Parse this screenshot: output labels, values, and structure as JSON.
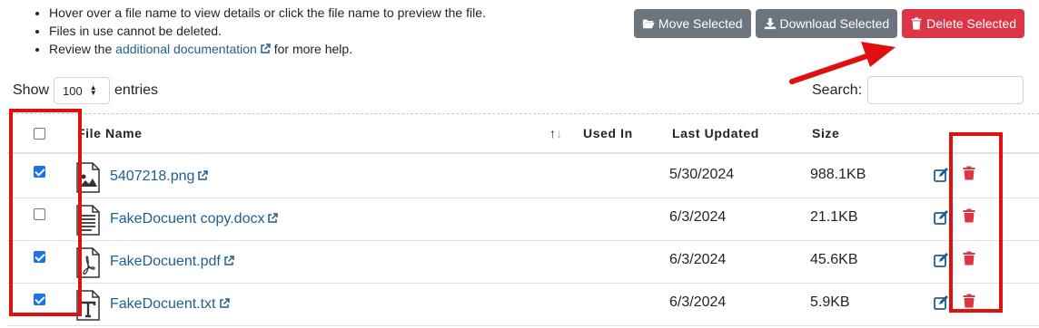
{
  "notes": {
    "hover": "Hover over a file name to view details or click the file name to preview the file.",
    "in_use": "Files in use cannot be deleted.",
    "review_prefix": "Review the ",
    "doc_link": "additional documentation",
    "review_suffix": " for more help."
  },
  "toolbar": {
    "move_label": "Move Selected",
    "download_label": "Download Selected",
    "delete_label": "Delete Selected"
  },
  "length": {
    "show_label": "Show",
    "value": "100",
    "entries_label": "entries"
  },
  "search": {
    "label": "Search:",
    "value": ""
  },
  "table": {
    "headers": {
      "file_name": "File Name",
      "used_in": "Used In",
      "last_updated": "Last Updated",
      "size": "Size"
    },
    "rows": [
      {
        "checked": true,
        "icon": "image-file-icon",
        "name": "5407218.png",
        "used_in": "",
        "updated": "5/30/2024",
        "size": "988.1KB"
      },
      {
        "checked": false,
        "icon": "document-file-icon",
        "name": "FakeDocuent copy.docx",
        "used_in": "",
        "updated": "6/3/2024",
        "size": "21.1KB"
      },
      {
        "checked": true,
        "icon": "pdf-file-icon",
        "name": "FakeDocuent.pdf",
        "used_in": "",
        "updated": "6/3/2024",
        "size": "45.6KB"
      },
      {
        "checked": true,
        "icon": "text-file-icon",
        "name": "FakeDocuent.txt",
        "used_in": "",
        "updated": "6/3/2024",
        "size": "5.9KB"
      }
    ]
  },
  "colors": {
    "link": "#1f5f8f",
    "danger": "#dc3545",
    "secondary": "#6c757d",
    "annotation": "#e01010"
  }
}
